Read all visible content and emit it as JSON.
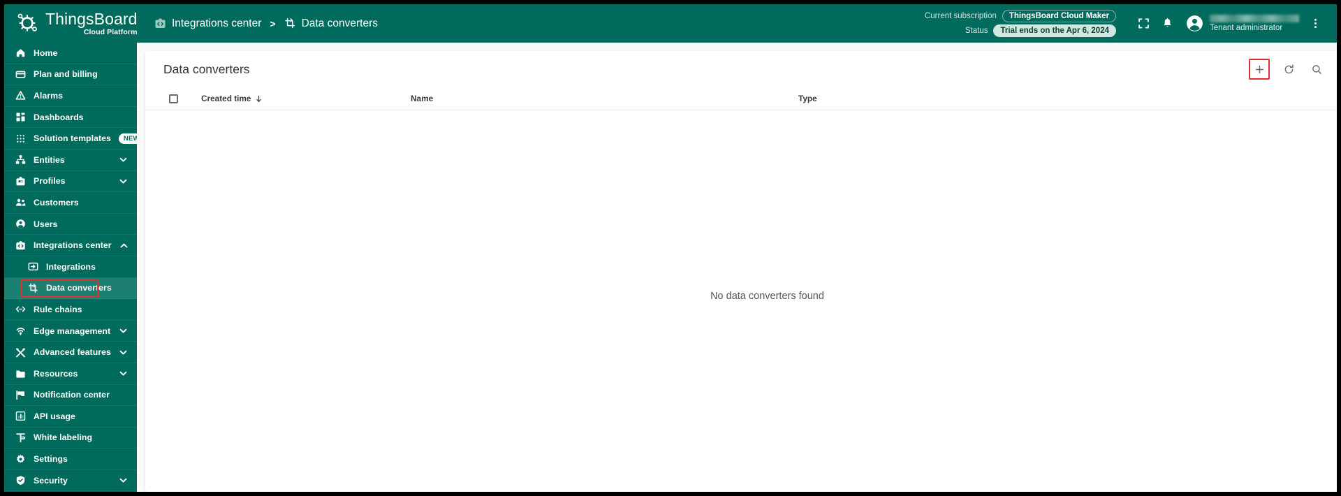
{
  "brand": {
    "title": "ThingsBoard",
    "subtitle": "Cloud Platform",
    "logo_icon": "thingsboard-logo-icon"
  },
  "breadcrumb": {
    "items": [
      {
        "label": "Integrations center",
        "icon": "integrations-center-icon"
      },
      {
        "label": "Data converters",
        "icon": "data-converters-icon"
      }
    ],
    "separator": ">"
  },
  "subscription": {
    "current_label": "Current subscription",
    "current_value": "ThingsBoard Cloud Maker",
    "status_label": "Status",
    "status_value": "Trial ends on the Apr 6, 2024"
  },
  "topbar_actions": {
    "fullscreen_icon": "fullscreen-icon",
    "notifications_icon": "bell-icon",
    "more_icon": "more-vertical-icon"
  },
  "user": {
    "name": "",
    "role": "Tenant administrator",
    "avatar_icon": "account-circle-icon"
  },
  "sidebar": {
    "items": [
      {
        "label": "Home",
        "icon": "home-icon",
        "level": 0,
        "expandable": false,
        "active": false
      },
      {
        "label": "Plan and billing",
        "icon": "credit-card-icon",
        "level": 0,
        "expandable": false,
        "active": false
      },
      {
        "label": "Alarms",
        "icon": "alarm-triangle-icon",
        "level": 0,
        "expandable": false,
        "active": false
      },
      {
        "label": "Dashboards",
        "icon": "dashboards-icon",
        "level": 0,
        "expandable": false,
        "active": false
      },
      {
        "label": "Solution templates",
        "icon": "solution-templates-icon",
        "level": 0,
        "expandable": false,
        "active": false,
        "badge": "NEW"
      },
      {
        "label": "Entities",
        "icon": "entities-icon",
        "level": 0,
        "expandable": true,
        "expanded": false,
        "active": false
      },
      {
        "label": "Profiles",
        "icon": "profiles-icon",
        "level": 0,
        "expandable": true,
        "expanded": false,
        "active": false
      },
      {
        "label": "Customers",
        "icon": "customers-icon",
        "level": 0,
        "expandable": false,
        "active": false
      },
      {
        "label": "Users",
        "icon": "user-circle-icon",
        "level": 0,
        "expandable": false,
        "active": false
      },
      {
        "label": "Integrations center",
        "icon": "integrations-center-icon",
        "level": 0,
        "expandable": true,
        "expanded": true,
        "active": false
      },
      {
        "label": "Integrations",
        "icon": "integrations-icon",
        "level": 1,
        "expandable": false,
        "active": false
      },
      {
        "label": "Data converters",
        "icon": "data-converters-icon",
        "level": 1,
        "expandable": false,
        "active": true,
        "annotated": true
      },
      {
        "label": "Rule chains",
        "icon": "rule-chains-icon",
        "level": 0,
        "expandable": false,
        "active": false
      },
      {
        "label": "Edge management",
        "icon": "edge-management-icon",
        "level": 0,
        "expandable": true,
        "expanded": false,
        "active": false
      },
      {
        "label": "Advanced features",
        "icon": "advanced-features-icon",
        "level": 0,
        "expandable": true,
        "expanded": false,
        "active": false
      },
      {
        "label": "Resources",
        "icon": "folder-icon",
        "level": 0,
        "expandable": true,
        "expanded": false,
        "active": false
      },
      {
        "label": "Notification center",
        "icon": "notification-flag-icon",
        "level": 0,
        "expandable": false,
        "active": false
      },
      {
        "label": "API usage",
        "icon": "api-usage-chart-icon",
        "level": 0,
        "expandable": false,
        "active": false
      },
      {
        "label": "White labeling",
        "icon": "white-labeling-icon",
        "level": 0,
        "expandable": false,
        "active": false
      },
      {
        "label": "Settings",
        "icon": "gear-icon",
        "level": 0,
        "expandable": false,
        "active": false
      },
      {
        "label": "Security",
        "icon": "shield-icon",
        "level": 0,
        "expandable": true,
        "expanded": false,
        "active": false
      }
    ]
  },
  "main": {
    "title": "Data converters",
    "actions": {
      "add_icon": "plus-icon",
      "refresh_icon": "refresh-icon",
      "search_icon": "search-icon"
    },
    "table": {
      "columns": [
        {
          "label": "Created time",
          "sort": "desc"
        },
        {
          "label": "Name",
          "sort": "none"
        },
        {
          "label": "Type",
          "sort": "none"
        }
      ],
      "rows": [],
      "empty_message": "No data converters found"
    }
  },
  "colors": {
    "brand_teal": "#006b5c",
    "active_teal": "#1c7f70",
    "annotation_red": "#e03030",
    "page_bg": "#fafafa"
  }
}
